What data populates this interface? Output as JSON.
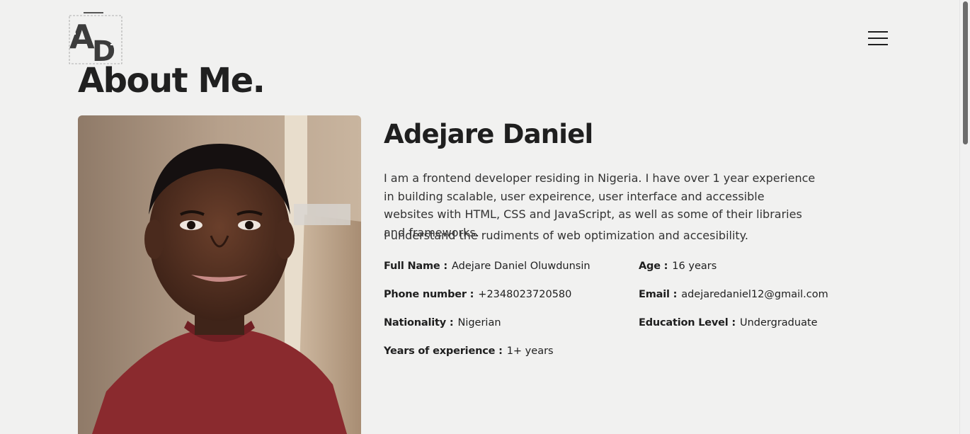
{
  "logo": {
    "text": "AD",
    "alt": "AD logo"
  },
  "nav": {
    "menu_icon": "hamburger-icon"
  },
  "page": {
    "title": "About Me."
  },
  "profile": {
    "name": "Adejare Daniel",
    "bio": "I am a frontend developer residing in Nigeria. I have over 1 year experience in building scalable, user expeirence, user interface and accessible websites with HTML, CSS and JavaScript, as well as some of their libraries and frameworks.",
    "bio_extra": "I understand the rudiments of web optimization and accesibility."
  },
  "details": {
    "full_name": {
      "label": "Full Name :",
      "value": "Adejare Daniel Oluwdunsin"
    },
    "age": {
      "label": "Age :",
      "value": "16 years"
    },
    "phone": {
      "label": "Phone number :",
      "value": "+2348023720580"
    },
    "email": {
      "label": "Email :",
      "value": "adejaredaniel12@gmail.com"
    },
    "nationality": {
      "label": "Nationality :",
      "value": "Nigerian"
    },
    "education": {
      "label": "Education Level :",
      "value": "Undergraduate"
    },
    "experience": {
      "label": "Years of experience :",
      "value": "1+ years"
    }
  },
  "colors": {
    "background": "#f1f1f0",
    "text": "#1f1f1f",
    "shirt": "#8a2a2e"
  }
}
